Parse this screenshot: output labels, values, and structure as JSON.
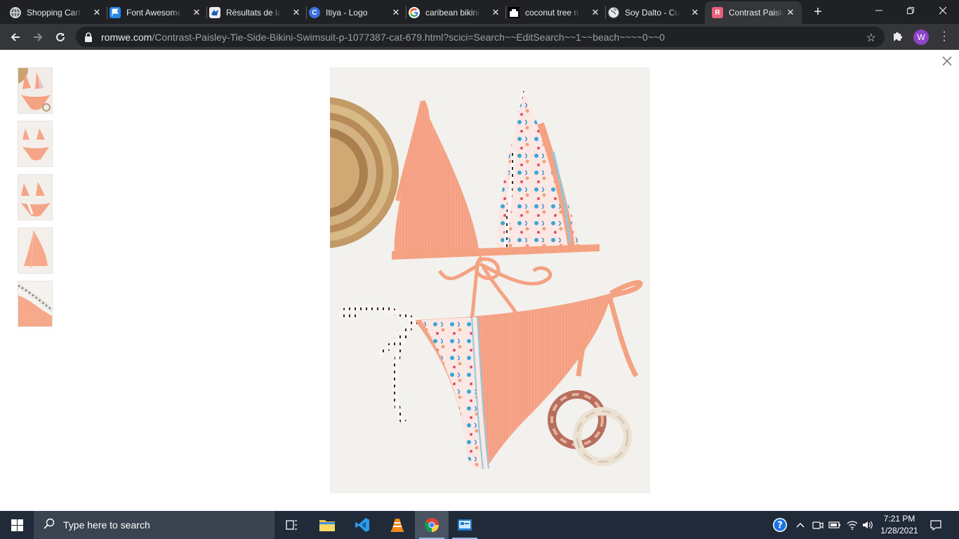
{
  "browser": {
    "tabs": [
      {
        "title": "Shopping Cart",
        "icon": "globe-icon"
      },
      {
        "title": "Font Awesome",
        "icon": "flag-icon"
      },
      {
        "title": "Résultats de la",
        "icon": "bird-icon"
      },
      {
        "title": "Itiya - Logo",
        "icon": "c-logo-icon"
      },
      {
        "title": "caribean bikini",
        "icon": "google-icon"
      },
      {
        "title": "coconut tree n",
        "icon": "coconut-icon"
      },
      {
        "title": "Soy Dalto - Cu",
        "icon": "globe-icon"
      },
      {
        "title": "Contrast Paisle",
        "icon": "romwe-icon",
        "active": true
      }
    ],
    "url_host": "romwe.com",
    "url_path": "/Contrast-Paisley-Tie-Side-Bikini-Swimsuit-p-1077387-cat-679.html?scici=Search~~EditSearch~~1~~beach~~~~0~~0",
    "profile_initial": "W"
  },
  "viewer": {
    "thumbnails": [
      "thumb-1",
      "thumb-2",
      "thumb-3",
      "thumb-4",
      "thumb-5"
    ],
    "main_image": "Contrast Paisley Tie Side Bikini Swimsuit"
  },
  "taskbar": {
    "search_placeholder": "Type here to search",
    "time": "7:21 PM",
    "date": "1/28/2021"
  },
  "colors": {
    "chrome_dark": "#202124",
    "chrome_toolbar": "#35363a",
    "taskbar": "#202a38",
    "bikini_coral": "#f6a384",
    "profile_purple": "#8e44c7"
  }
}
